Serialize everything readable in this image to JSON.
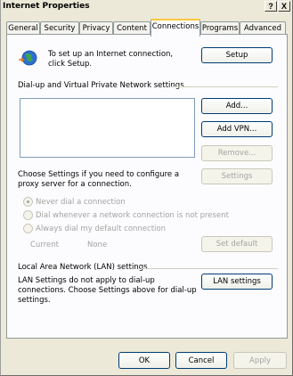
{
  "window": {
    "title": "Internet Properties",
    "help_glyph": "?",
    "close_glyph": "X"
  },
  "tabs": [
    {
      "label": "General"
    },
    {
      "label": "Security"
    },
    {
      "label": "Privacy"
    },
    {
      "label": "Content"
    },
    {
      "label": "Connections",
      "active": true
    },
    {
      "label": "Programs"
    },
    {
      "label": "Advanced"
    }
  ],
  "setup": {
    "text": "To set up an Internet connection, click Setup.",
    "button": "Setup",
    "icon": "globe-connection-icon"
  },
  "dialup": {
    "group_label": "Dial-up and Virtual Private Network settings",
    "add_button": "Add...",
    "add_vpn_button": "Add VPN...",
    "remove_button": "Remove...",
    "settings_text": "Choose Settings if you need to configure a proxy server for a connection.",
    "settings_button": "Settings",
    "radio_never": "Never dial a connection",
    "radio_whenever": "Dial whenever a network connection is not present",
    "radio_always": "Always dial my default connection",
    "current_label": "Current",
    "current_value": "None",
    "set_default_button": "Set default"
  },
  "lan": {
    "group_label": "Local Area Network (LAN) settings",
    "text": "LAN Settings do not apply to dial-up connections. Choose Settings above for dial-up settings.",
    "button": "LAN settings"
  },
  "footer": {
    "ok": "OK",
    "cancel": "Cancel",
    "apply": "Apply"
  }
}
